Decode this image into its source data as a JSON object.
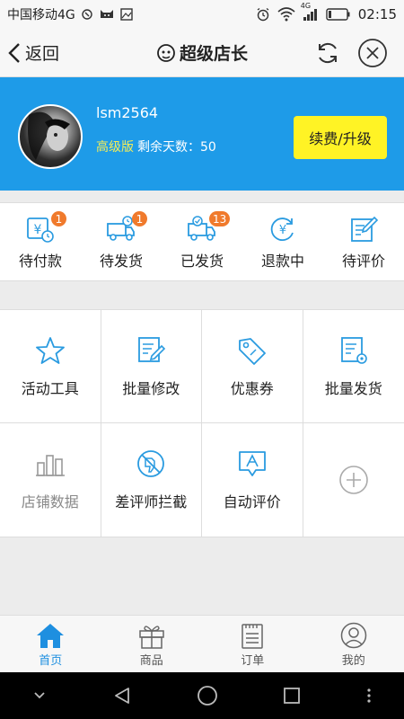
{
  "status_bar": {
    "carrier": "中国移动4G",
    "network_badge": "4G",
    "time": "02:15",
    "icons": [
      "signal-app-icon",
      "cat-icon",
      "image-icon",
      "alarm-icon",
      "wifi-icon",
      "cell-signal-icon",
      "battery-icon"
    ]
  },
  "nav": {
    "back_label": "返回",
    "title": "超级店长",
    "actions": [
      "refresh-icon",
      "close-icon"
    ]
  },
  "profile": {
    "username": "lsm2564",
    "plan": "高级版",
    "days_label": "剩余天数：",
    "days_value": "50",
    "upgrade_label": "续费/升级"
  },
  "orders": [
    {
      "label": "待付款",
      "icon": "pending-payment-icon",
      "badge": "1"
    },
    {
      "label": "待发货",
      "icon": "pending-shipment-icon",
      "badge": "1"
    },
    {
      "label": "已发货",
      "icon": "shipped-icon",
      "badge": "13"
    },
    {
      "label": "退款中",
      "icon": "refund-icon",
      "badge": ""
    },
    {
      "label": "待评价",
      "icon": "pending-review-icon",
      "badge": ""
    }
  ],
  "tools": [
    {
      "label": "活动工具",
      "icon": "star-icon"
    },
    {
      "label": "批量修改",
      "icon": "batch-edit-icon"
    },
    {
      "label": "优惠券",
      "icon": "coupon-tag-icon"
    },
    {
      "label": "批量发货",
      "icon": "batch-ship-icon"
    },
    {
      "label": "店铺数据",
      "icon": "bar-chart-icon"
    },
    {
      "label": "差评师拦截",
      "icon": "block-thumb-down-icon"
    },
    {
      "label": "自动评价",
      "icon": "auto-review-icon"
    },
    {
      "label": "",
      "icon": "add-circle-icon"
    }
  ],
  "tabs": [
    {
      "label": "首页",
      "icon": "home-icon",
      "active": true
    },
    {
      "label": "商品",
      "icon": "gift-box-icon",
      "active": false
    },
    {
      "label": "订单",
      "icon": "order-list-icon",
      "active": false
    },
    {
      "label": "我的",
      "icon": "user-icon",
      "active": false
    }
  ],
  "colors": {
    "header_blue": "#1e9be8",
    "upgrade_yellow": "#fff325",
    "plan_yellow": "#f5ed58",
    "badge_orange": "#f07a2c",
    "icon_blue": "#2a9be0",
    "tab_active": "#1e8fe0"
  }
}
